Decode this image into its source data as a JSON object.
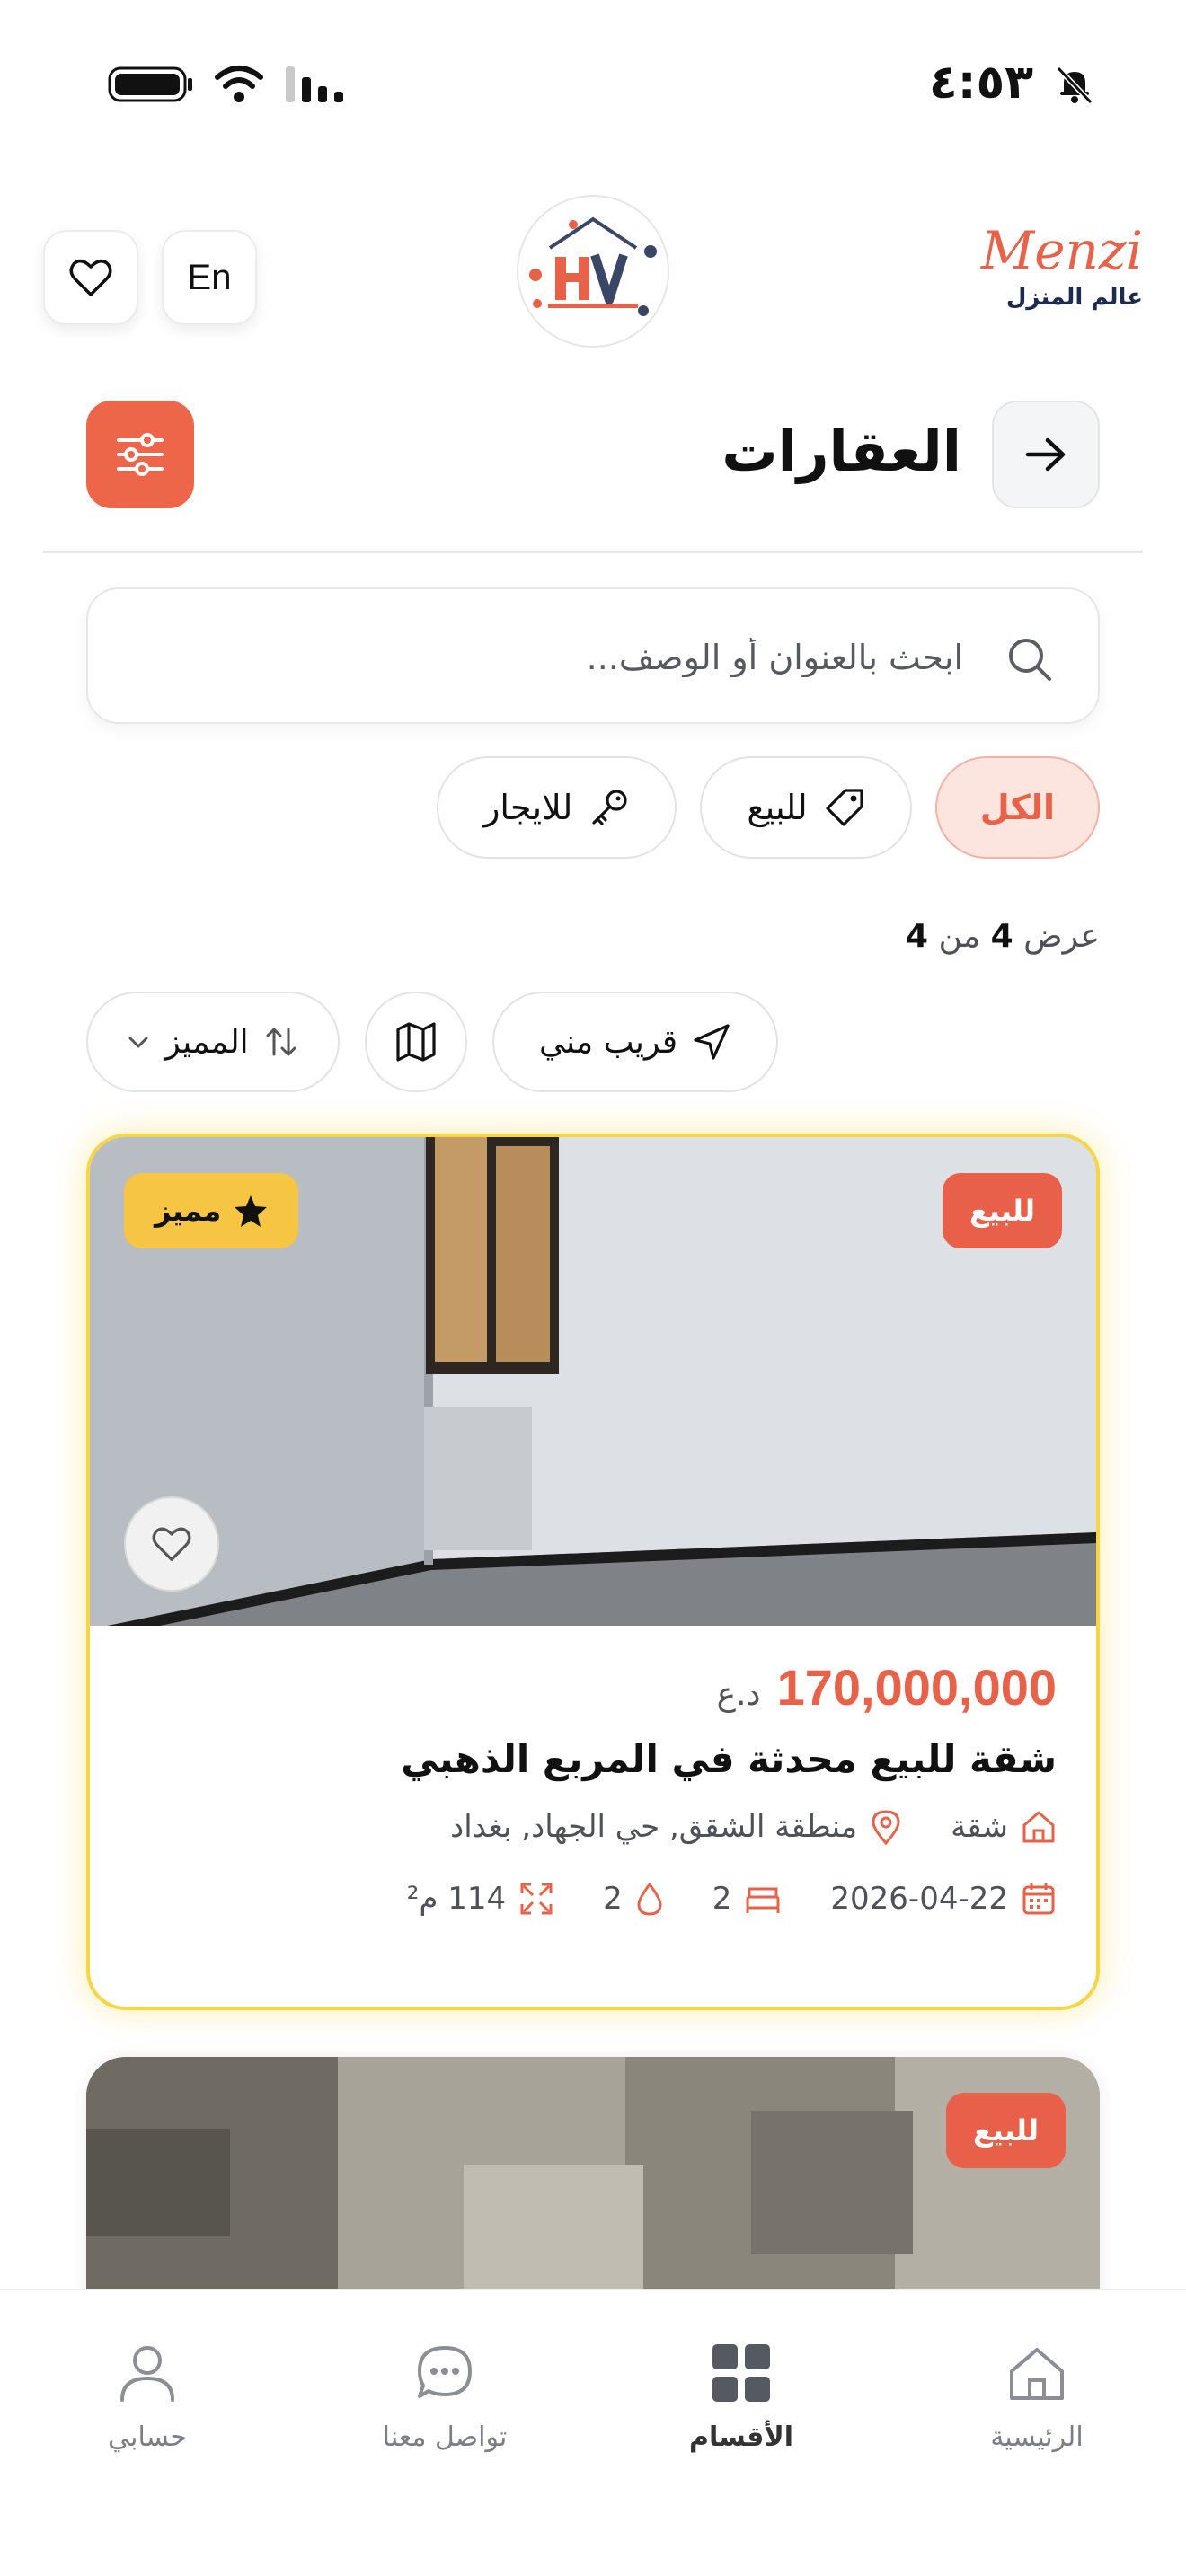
{
  "status_bar": {
    "time": "٤:٥٣"
  },
  "header": {
    "brand_name": "Menzi",
    "brand_subtitle": "عالم المنزل",
    "language_label": "En"
  },
  "page": {
    "title": "العقارات"
  },
  "search": {
    "placeholder": "ابحث بالعنوان أو الوصف...",
    "value": ""
  },
  "filters": {
    "chips": [
      {
        "label": "الكل",
        "active": true
      },
      {
        "label": "للبيع",
        "active": false
      },
      {
        "label": "للايجار",
        "active": false
      }
    ]
  },
  "results": {
    "prefix": "عرض",
    "shown": "4",
    "of": "من",
    "total": "4"
  },
  "tools": {
    "sort_label": "المميز",
    "nearby_label": "قريب مني"
  },
  "listings": [
    {
      "badge": "للبيع",
      "featured_label": "مميز",
      "price": "170,000,000",
      "currency": "د.ع",
      "title": "شقة للبيع محدثة في المربع الذهبي",
      "type": "شقة",
      "location": "منطقة الشقق, حي الجهاد, بغداد",
      "date": "2026-04-22",
      "bedrooms": "2",
      "bathrooms": "2",
      "area": "114 م²"
    },
    {
      "badge": "للبيع"
    }
  ],
  "tabbar": {
    "items": [
      {
        "label": "الرئيسية",
        "icon": "home-icon"
      },
      {
        "label": "الأقسام",
        "icon": "grid-icon",
        "active": true
      },
      {
        "label": "تواصل معنا",
        "icon": "chat-icon"
      },
      {
        "label": "حسابي",
        "icon": "user-icon"
      }
    ]
  },
  "colors": {
    "accent": "#e8624a",
    "featured_border": "#f6d646",
    "featured_badge": "#f5c543"
  }
}
